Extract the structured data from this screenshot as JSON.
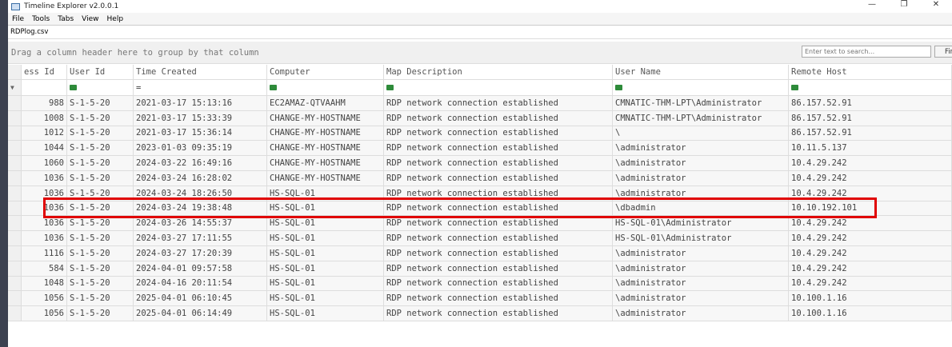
{
  "window": {
    "title": "Timeline Explorer v2.0.0.1",
    "controls": [
      "—",
      "❐",
      "✕"
    ]
  },
  "menu": [
    "File",
    "Tools",
    "Tabs",
    "View",
    "Help"
  ],
  "tab": "RDPlog.csv",
  "group_hint": "Drag a column header here to group by that column",
  "search": {
    "placeholder": "Enter text to search...",
    "find_label": "Find"
  },
  "columns": [
    "ess Id",
    "User Id",
    "Time Created",
    "Computer",
    "Map Description",
    "User Name",
    "Remote Host"
  ],
  "filter_icons": [
    "",
    "text-filter-icon",
    "equals-filter-icon",
    "text-filter-icon",
    "text-filter-icon",
    "text-filter-icon",
    "text-filter-icon"
  ],
  "rows": [
    [
      "988",
      "S-1-5-20",
      "2021-03-17 15:13:16",
      "EC2AMAZ-QTVAAHM",
      "RDP network connection established",
      "CMNATIC-THM-LPT\\Administrator",
      "86.157.52.91"
    ],
    [
      "1008",
      "S-1-5-20",
      "2021-03-17 15:33:39",
      "CHANGE-MY-HOSTNAME",
      "RDP network connection established",
      "CMNATIC-THM-LPT\\Administrator",
      "86.157.52.91"
    ],
    [
      "1012",
      "S-1-5-20",
      "2021-03-17 15:36:14",
      "CHANGE-MY-HOSTNAME",
      "RDP network connection established",
      "\\",
      "86.157.52.91"
    ],
    [
      "1044",
      "S-1-5-20",
      "2023-01-03 09:35:19",
      "CHANGE-MY-HOSTNAME",
      "RDP network connection established",
      "\\administrator",
      "10.11.5.137"
    ],
    [
      "1060",
      "S-1-5-20",
      "2024-03-22 16:49:16",
      "CHANGE-MY-HOSTNAME",
      "RDP network connection established",
      "\\administrator",
      "10.4.29.242"
    ],
    [
      "1036",
      "S-1-5-20",
      "2024-03-24 16:28:02",
      "CHANGE-MY-HOSTNAME",
      "RDP network connection established",
      "\\administrator",
      "10.4.29.242"
    ],
    [
      "1036",
      "S-1-5-20",
      "2024-03-24 18:26:50",
      "HS-SQL-01",
      "RDP network connection established",
      "\\administrator",
      "10.4.29.242"
    ],
    [
      "1036",
      "S-1-5-20",
      "2024-03-24 19:38:48",
      "HS-SQL-01",
      "RDP network connection established",
      "\\dbadmin",
      "10.10.192.101"
    ],
    [
      "1036",
      "S-1-5-20",
      "2024-03-26 14:55:37",
      "HS-SQL-01",
      "RDP network connection established",
      "HS-SQL-01\\Administrator",
      "10.4.29.242"
    ],
    [
      "1036",
      "S-1-5-20",
      "2024-03-27 17:11:55",
      "HS-SQL-01",
      "RDP network connection established",
      "HS-SQL-01\\Administrator",
      "10.4.29.242"
    ],
    [
      "1116",
      "S-1-5-20",
      "2024-03-27 17:20:39",
      "HS-SQL-01",
      "RDP network connection established",
      "\\administrator",
      "10.4.29.242"
    ],
    [
      "584",
      "S-1-5-20",
      "2024-04-01 09:57:58",
      "HS-SQL-01",
      "RDP network connection established",
      "\\administrator",
      "10.4.29.242"
    ],
    [
      "1048",
      "S-1-5-20",
      "2024-04-16 20:11:54",
      "HS-SQL-01",
      "RDP network connection established",
      "\\administrator",
      "10.4.29.242"
    ],
    [
      "1056",
      "S-1-5-20",
      "2025-04-01 06:10:45",
      "HS-SQL-01",
      "RDP network connection established",
      "\\administrator",
      "10.100.1.16"
    ],
    [
      "1056",
      "S-1-5-20",
      "2025-04-01 06:14:49",
      "HS-SQL-01",
      "RDP network connection established",
      "\\administrator",
      "10.100.1.16"
    ]
  ],
  "highlight_color": "#e00000"
}
